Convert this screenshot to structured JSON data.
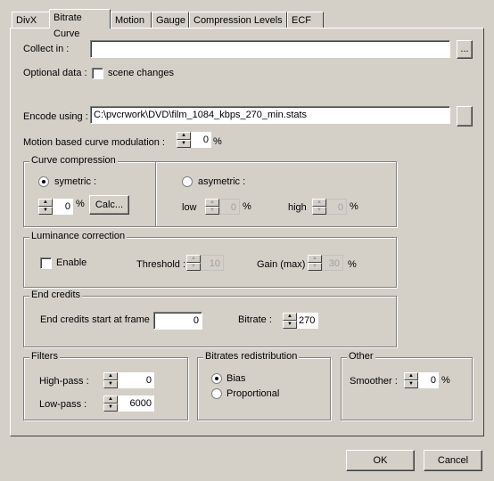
{
  "tabs": [
    "DivX",
    "Bitrate Curve",
    "Motion",
    "Gauge",
    "Compression Levels",
    "ECF"
  ],
  "active_tab": "Bitrate Curve",
  "collect_in": {
    "label": "Collect in :",
    "value": "",
    "browse": "..."
  },
  "optional_data": {
    "label": "Optional data :",
    "checkbox": "scene changes",
    "checked": false
  },
  "encode_using": {
    "label": "Encode using :",
    "value": "C:\\pvcrwork\\DVD\\film_1084_kbps_270_min.stats"
  },
  "motion": {
    "label": "Motion based curve modulation :",
    "value": "0",
    "unit": "%"
  },
  "curve_compression": {
    "title": "Curve compression",
    "symetric": "symetric :",
    "sym_value": "0",
    "unit": "%",
    "calc": "Calc...",
    "asymetric": "asymetric :",
    "low": "low",
    "low_value": "0",
    "high": "high",
    "high_value": "0",
    "selected": "symetric"
  },
  "luminance": {
    "title": "Luminance correction",
    "enable": "Enable",
    "enabled": false,
    "threshold_label": "Threshold :",
    "threshold": "10",
    "gain_label": "Gain (max) :",
    "gain": "30",
    "unit": "%"
  },
  "end_credits": {
    "title": "End credits",
    "start_label": "End credits start at frame :",
    "start": "0",
    "bitrate_label": "Bitrate :",
    "bitrate": "270"
  },
  "filters": {
    "title": "Filters",
    "highpass_label": "High-pass :",
    "highpass": "0",
    "lowpass_label": "Low-pass :",
    "lowpass": "6000"
  },
  "redistribution": {
    "title": "Bitrates redistribution",
    "options": [
      "Bias",
      "Proportional"
    ],
    "selected": "Bias"
  },
  "other": {
    "title": "Other",
    "smoother_label": "Smoother :",
    "smoother": "0",
    "unit": "%"
  },
  "buttons": {
    "ok": "OK",
    "cancel": "Cancel"
  }
}
